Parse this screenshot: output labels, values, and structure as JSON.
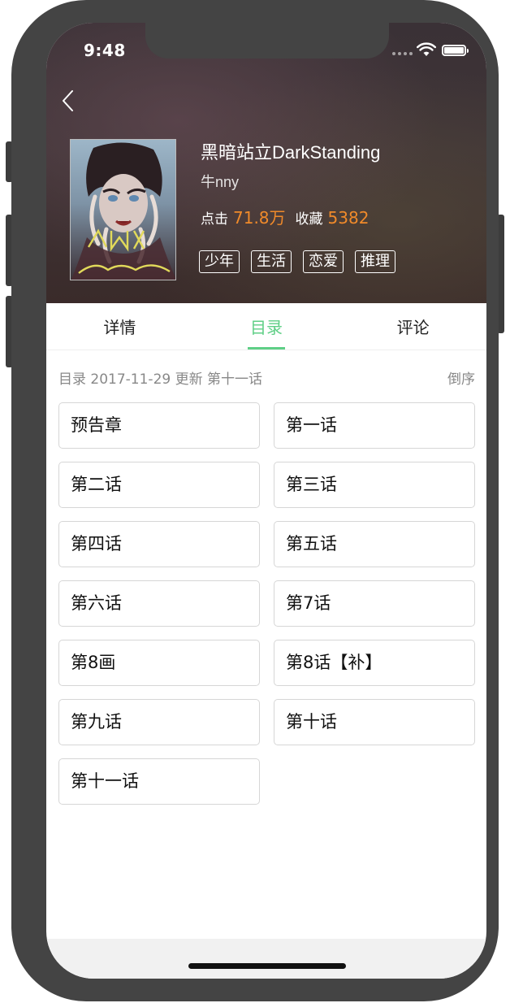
{
  "status_bar": {
    "time": "9:48"
  },
  "comic": {
    "title": "黑暗站立DarkStanding",
    "author": "牛nny",
    "clicks_label": "点击",
    "clicks_value": "71.8万",
    "favorites_label": "收藏",
    "favorites_value": "5382",
    "tags": [
      "少年",
      "生活",
      "恋爱",
      "推理"
    ]
  },
  "tabs": [
    {
      "label": "详情",
      "active": false
    },
    {
      "label": "目录",
      "active": true
    },
    {
      "label": "评论",
      "active": false
    }
  ],
  "toc": {
    "summary": "目录 2017-11-29 更新 第十一话",
    "sort_label": "倒序",
    "chapters": [
      "预告章",
      "第一话",
      "第二话",
      "第三话",
      "第四话",
      "第五话",
      "第六话",
      "第7话",
      "第8画",
      "第8话【补】",
      "第九话",
      "第十话",
      "第十一话"
    ]
  },
  "colors": {
    "accent_green": "#5fcf86",
    "stat_orange": "#f08a2a",
    "frame": "#444444"
  },
  "icons": [
    "back-chevron-icon",
    "wifi-icon",
    "battery-icon",
    "cellular-signal-icon"
  ]
}
